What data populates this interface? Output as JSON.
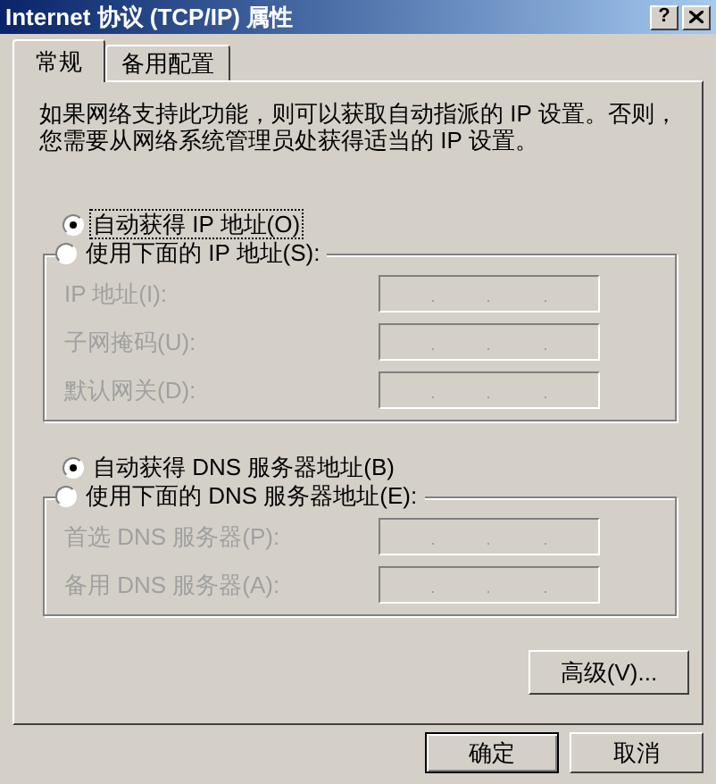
{
  "window": {
    "title": "Internet 协议 (TCP/IP) 属性",
    "buttons": [
      {
        "kind": "help",
        "label": "?"
      },
      {
        "kind": "close"
      }
    ]
  },
  "tabs": [
    {
      "label": "常规",
      "selected": true
    },
    {
      "label": "备用配置",
      "selected": false
    }
  ],
  "description_lines": [
    "如果网络支持此功能，则可以获取自动指派的 IP 设置。否则，",
    "您需要从网络系统管理员处获得适当的 IP 设置。"
  ],
  "sections": [
    {
      "auto_radio": {
        "label": "自动获得 IP 地址(O)",
        "selected": true,
        "focused": true
      },
      "manual_radio": {
        "label": "使用下面的 IP 地址(S):",
        "selected": false
      },
      "fields": [
        {
          "label": "IP 地址(I):",
          "disabled": true
        },
        {
          "label": "子网掩码(U):",
          "disabled": true
        },
        {
          "label": "默认网关(D):",
          "disabled": true
        }
      ]
    },
    {
      "auto_radio": {
        "label": "自动获得 DNS 服务器地址(B)",
        "selected": true,
        "focused": false
      },
      "manual_radio": {
        "label": "使用下面的 DNS 服务器地址(E):",
        "selected": false
      },
      "fields": [
        {
          "label": "首选 DNS 服务器(P):",
          "disabled": true
        },
        {
          "label": "备用 DNS 服务器(A):",
          "disabled": true
        }
      ]
    }
  ],
  "advanced_button": "高级(V)...",
  "buttons": [
    {
      "label": "确定",
      "default": true
    },
    {
      "label": "取消",
      "default": false
    }
  ]
}
